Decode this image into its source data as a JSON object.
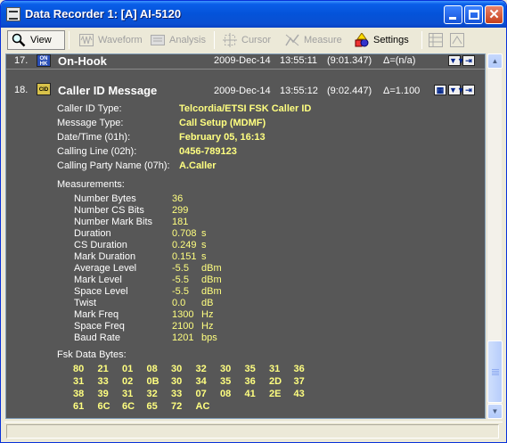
{
  "window": {
    "title": "Data Recorder 1:  [A] AI-5120"
  },
  "toolbar": {
    "view": "View",
    "waveform": "Waveform",
    "analysis": "Analysis",
    "cursor": "Cursor",
    "measure": "Measure",
    "settings": "Settings"
  },
  "events": [
    {
      "index": "17.",
      "title": "On-Hook",
      "date": "2009-Dec-14",
      "time": "13:55:11",
      "offset": "(9:01.347)",
      "delta": "Δ=(n/a)",
      "icon_label": "ON HK"
    },
    {
      "index": "18.",
      "title": "Caller ID Message",
      "date": "2009-Dec-14",
      "time": "13:55:12",
      "offset": "(9:02.447)",
      "delta": "Δ=1.100",
      "icon_label": "CID"
    }
  ],
  "details": {
    "fields": [
      {
        "label": "Caller ID Type:",
        "value": "Telcordia/ETSI FSK Caller ID"
      },
      {
        "label": "Message Type:",
        "value": "Call Setup (MDMF)"
      },
      {
        "label": "Date/Time (01h):",
        "value": "February 05, 16:13"
      },
      {
        "label": "Calling Line (02h):",
        "value": "0456-789123"
      },
      {
        "label": "Calling Party Name (07h):",
        "value": "A.Caller"
      }
    ],
    "measurements_title": "Measurements:",
    "measurements": [
      {
        "label": "Number Bytes",
        "value": "36",
        "unit": ""
      },
      {
        "label": "Number CS Bits",
        "value": "299",
        "unit": ""
      },
      {
        "label": "Number Mark Bits",
        "value": "181",
        "unit": ""
      },
      {
        "label": "Duration",
        "value": "0.708",
        "unit": "s"
      },
      {
        "label": "CS Duration",
        "value": "0.249",
        "unit": "s"
      },
      {
        "label": "Mark Duration",
        "value": "0.151",
        "unit": "s"
      },
      {
        "label": "Average Level",
        "value": "-5.5",
        "unit": "dBm"
      },
      {
        "label": "Mark Level",
        "value": "-5.5",
        "unit": "dBm"
      },
      {
        "label": "Space Level",
        "value": "-5.5",
        "unit": "dBm"
      },
      {
        "label": "Twist",
        "value": "0.0",
        "unit": "dB"
      },
      {
        "label": "Mark Freq",
        "value": "1300",
        "unit": "Hz"
      },
      {
        "label": "Space Freq",
        "value": "2100",
        "unit": "Hz"
      },
      {
        "label": "Baud Rate",
        "value": "1201",
        "unit": "bps"
      }
    ],
    "fsk_title": "Fsk Data Bytes:",
    "fsk_rows": [
      [
        "80",
        "21",
        "01",
        "08",
        "30",
        "32",
        "30",
        "35",
        "31",
        "36"
      ],
      [
        "31",
        "33",
        "02",
        "0B",
        "30",
        "34",
        "35",
        "36",
        "2D",
        "37"
      ],
      [
        "38",
        "39",
        "31",
        "32",
        "33",
        "07",
        "08",
        "41",
        "2E",
        "43"
      ],
      [
        "61",
        "6C",
        "6C",
        "65",
        "72",
        "AC"
      ]
    ]
  },
  "colors": {
    "background": "#575757",
    "label": "#ffffff",
    "value": "#ffff80",
    "title_bar": "#0453d9"
  }
}
